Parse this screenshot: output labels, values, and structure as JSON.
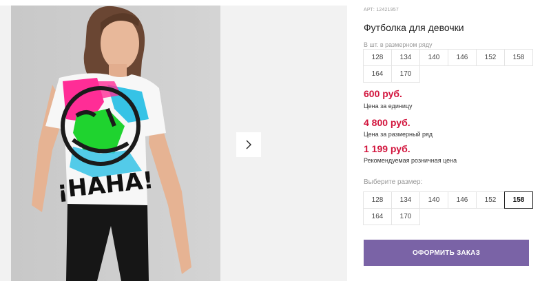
{
  "product": {
    "article": "АРТ: 12421957",
    "title": "Футболка для девочки",
    "image_alt": "Фото товара",
    "print_text": "¡HAHA!"
  },
  "pack": {
    "caption": "В шт. в размерном ряду",
    "sizes": [
      "128",
      "134",
      "140",
      "146",
      "152",
      "158",
      "164",
      "170"
    ]
  },
  "prices": {
    "unit_price": "600 руб.",
    "unit_caption": "Цена за единицу",
    "pack_price": "4 800 руб.",
    "pack_caption": "Цена за размерный ряд",
    "retail_price": "1 199 руб.",
    "retail_caption": "Рекомендуемая розничная цена",
    "accent_color": "#d2153d"
  },
  "size_select": {
    "caption": "Выберите размер:",
    "sizes": [
      "128",
      "134",
      "140",
      "146",
      "152",
      "158",
      "164",
      "170"
    ],
    "selected": "158"
  },
  "gallery": {
    "next_icon": "chevron-right-icon"
  },
  "order": {
    "label": "Оформить заказ",
    "color": "#7a63a6"
  }
}
